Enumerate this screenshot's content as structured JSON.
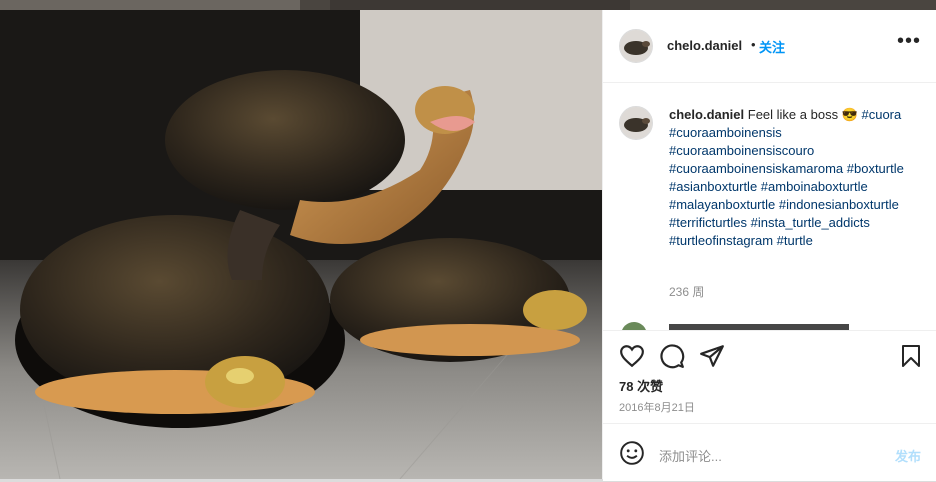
{
  "post": {
    "username": "chelo.daniel",
    "separator": "•",
    "follow_label": "关注",
    "more_label": "•••"
  },
  "caption": {
    "username": "chelo.daniel",
    "text": " Feel like a boss 😎 ",
    "hashtags": "#cuora #cuoraamboinensis #cuoraamboinensiscouro #cuoraamboinensiskamaroma #boxturtle #asianboxturtle #amboinaboxturtle #malayanboxturtle #indonesianboxturtle #terrificturtles #insta_turtle_addicts #turtleofinstagram #turtle",
    "time_ago": "236 周"
  },
  "actions": {
    "likes": "78 次赞",
    "date": "2016年8月21日"
  },
  "comment_box": {
    "placeholder": "添加评论...",
    "post_label": "发布"
  },
  "icons": [
    "heart-icon",
    "comment-icon",
    "share-icon",
    "bookmark-icon",
    "emoji-icon",
    "more-options-icon"
  ],
  "colors": {
    "accent": "#0095f6",
    "hashtag": "#00376b",
    "muted": "#8e8e8e",
    "post_disabled": "#b2dffc"
  }
}
